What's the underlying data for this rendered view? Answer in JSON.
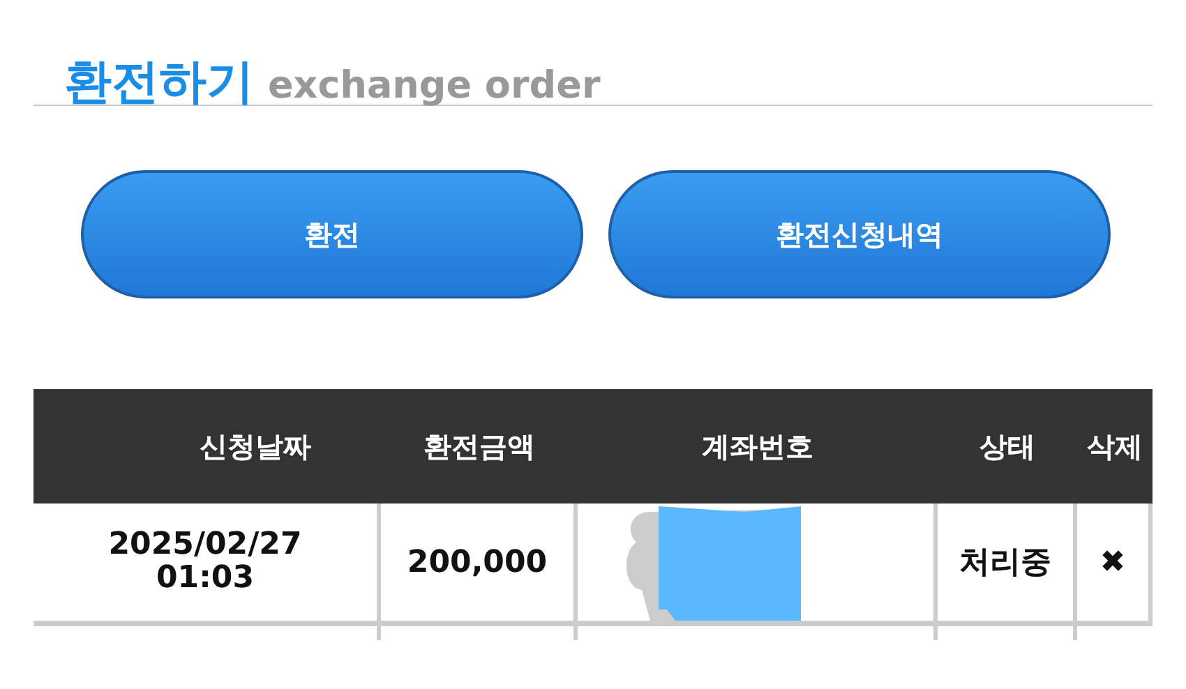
{
  "header": {
    "title": "환전하기",
    "subtitle": "exchange order"
  },
  "buttons": [
    "환전",
    "환전신청내역"
  ],
  "table": {
    "columns": [
      "신청날짜",
      "환전금액",
      "계좌번호",
      "상태",
      "삭제"
    ],
    "rows": [
      {
        "date": "2025/02/27",
        "time": "01:03",
        "amount": "200,000",
        "account": {
          "kind": "redacted"
        },
        "status": "처리중",
        "delete": "✖"
      }
    ]
  }
}
